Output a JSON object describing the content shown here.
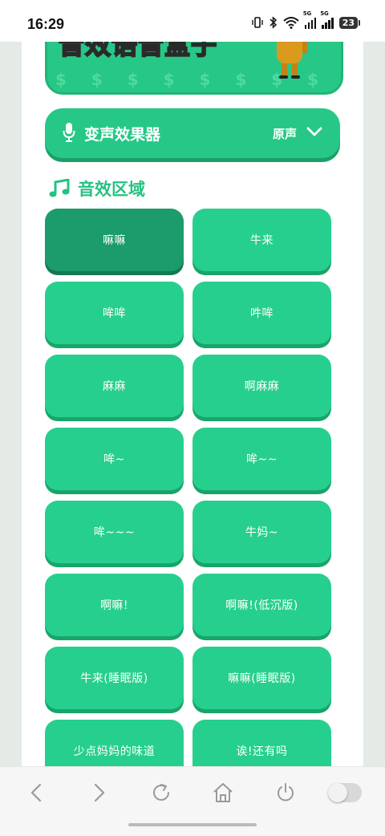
{
  "status_bar": {
    "time": "16:29",
    "network_label_1": "5G",
    "network_label_2": "5G",
    "battery": "23"
  },
  "banner": {
    "title": "音效语音盒子",
    "pattern": "$ $ $ $ $ $ $ $ $"
  },
  "voice_changer": {
    "title": "变声效果器",
    "value": "原声"
  },
  "section": {
    "title": "音效区域"
  },
  "sounds": [
    {
      "label": "嘛嘛"
    },
    {
      "label": "牛来"
    },
    {
      "label": "哞哞"
    },
    {
      "label": "吽哞"
    },
    {
      "label": "麻麻"
    },
    {
      "label": "啊麻麻"
    },
    {
      "label": "哞~"
    },
    {
      "label": "哞~~"
    },
    {
      "label": "哞~~~"
    },
    {
      "label": "牛妈~"
    },
    {
      "label": "啊嘛!"
    },
    {
      "label": "啊嘛!(低沉版)"
    },
    {
      "label": "牛来(睡眠版)"
    },
    {
      "label": "嘛嘛(睡眠版)"
    },
    {
      "label": "少点妈妈的味道"
    },
    {
      "label": "诶!还有吗"
    }
  ],
  "colors": {
    "accent": "#27c887",
    "accent_dark": "#1b9c6a",
    "section_title": "#25c283"
  },
  "icons": [
    "mic-icon",
    "chevron-down-icon",
    "music-note-icon",
    "back-icon",
    "forward-icon",
    "refresh-icon",
    "home-icon",
    "power-icon"
  ]
}
